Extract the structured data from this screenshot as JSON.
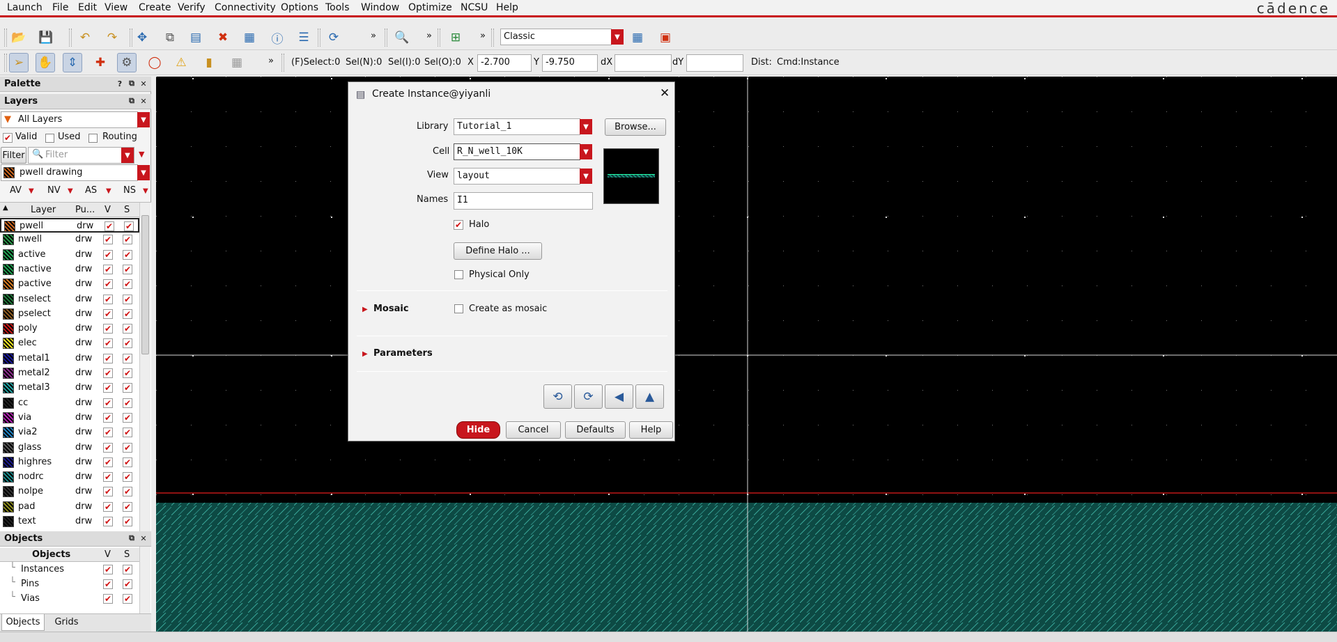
{
  "brand": "cādence",
  "menu": [
    "Launch",
    "File",
    "Edit",
    "View",
    "Create",
    "Verify",
    "Connectivity",
    "Options",
    "Tools",
    "Window",
    "Optimize",
    "NCSU",
    "Help"
  ],
  "toolbar1": {
    "workspace": "Classic",
    "overflow": "»"
  },
  "toolbar2": {
    "overflow": "»",
    "select_info": "(F)Select:0",
    "sel_n": "Sel(N):0",
    "sel_i": "Sel(I):0",
    "sel_o": "Sel(O):0",
    "x_label": "X",
    "x_value": "-2.700",
    "y_label": "Y",
    "y_value": "-9.750",
    "dx_label": "dX",
    "dx_value": "",
    "dy_label": "dY",
    "dy_value": "",
    "dist_label": "Dist:",
    "cmd": "Cmd:Instance"
  },
  "palette": {
    "title": "Palette"
  },
  "layers": {
    "title": "Layers",
    "filter_combo": "All Layers",
    "valid": "Valid",
    "used": "Used",
    "routing": "Routing",
    "filter_button": "Filter",
    "filter_placeholder": "Filter",
    "current": "pwell drawing",
    "vis": [
      "AV",
      "NV",
      "AS",
      "NS"
    ],
    "columns": [
      "Layer",
      "Pu...",
      "V",
      "S"
    ],
    "rows": [
      {
        "name": "pwell",
        "purpose": "drw",
        "color": "#c8641e"
      },
      {
        "name": "nwell",
        "purpose": "drw",
        "color": "#2a9a4a"
      },
      {
        "name": "active",
        "purpose": "drw",
        "color": "#1ea050"
      },
      {
        "name": "nactive",
        "purpose": "drw",
        "color": "#1ea050"
      },
      {
        "name": "pactive",
        "purpose": "drw",
        "color": "#d07820"
      },
      {
        "name": "nselect",
        "purpose": "drw",
        "color": "#1f7a3a"
      },
      {
        "name": "pselect",
        "purpose": "drw",
        "color": "#8a5a20"
      },
      {
        "name": "poly",
        "purpose": "drw",
        "color": "#c81818"
      },
      {
        "name": "elec",
        "purpose": "drw",
        "color": "#e8e020"
      },
      {
        "name": "metal1",
        "purpose": "drw",
        "color": "#1a1a9a"
      },
      {
        "name": "metal2",
        "purpose": "drw",
        "color": "#8a2a8a"
      },
      {
        "name": "metal3",
        "purpose": "drw",
        "color": "#20a0a0"
      },
      {
        "name": "cc",
        "purpose": "drw",
        "color": "#222222"
      },
      {
        "name": "via",
        "purpose": "drw",
        "color": "#b020b0"
      },
      {
        "name": "via2",
        "purpose": "drw",
        "color": "#2080c0"
      },
      {
        "name": "glass",
        "purpose": "drw",
        "color": "#555555"
      },
      {
        "name": "highres",
        "purpose": "drw",
        "color": "#1a1a8a"
      },
      {
        "name": "nodrc",
        "purpose": "drw",
        "color": "#1a8a8a"
      },
      {
        "name": "nolpe",
        "purpose": "drw",
        "color": "#333333"
      },
      {
        "name": "pad",
        "purpose": "drw",
        "color": "#8a8a1a"
      },
      {
        "name": "text",
        "purpose": "drw",
        "color": "#222222"
      }
    ]
  },
  "objects": {
    "title": "Objects",
    "columns": [
      "Objects",
      "V",
      "S"
    ],
    "rows": [
      "Instances",
      "Pins",
      "Vias"
    ],
    "tabs": [
      "Objects",
      "Grids"
    ]
  },
  "dialog": {
    "title": "Create Instance@yiyanli",
    "library_label": "Library",
    "library_value": "Tutorial_1",
    "browse": "Browse...",
    "cell_label": "Cell",
    "cell_value": "R_N_well_10K",
    "view_label": "View",
    "view_value": "layout",
    "names_label": "Names",
    "names_value": "I1",
    "halo": "Halo",
    "define_halo": "Define Halo ...",
    "physical_only": "Physical Only",
    "mosaic": "Mosaic",
    "create_as_mosaic": "Create as mosaic",
    "parameters": "Parameters",
    "hide": "Hide",
    "cancel": "Cancel",
    "defaults": "Defaults",
    "help": "Help"
  }
}
